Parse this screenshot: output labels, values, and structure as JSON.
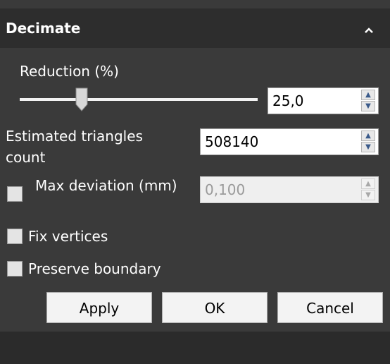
{
  "panel": {
    "title": "Decimate",
    "collapse_icon": "chevron-up-icon"
  },
  "reduction": {
    "label": "Reduction (%)",
    "value": "25,0",
    "slider_fraction": 0.26
  },
  "triangles": {
    "label_line1": "Estimated triangles",
    "label_line2": "count",
    "value": "508140"
  },
  "deviation": {
    "label": "Max deviation (mm)",
    "value": "0,100",
    "checked": false,
    "enabled": false
  },
  "fix_vertices": {
    "label": "Fix vertices",
    "checked": false
  },
  "preserve_boundary": {
    "label": "Preserve boundary",
    "checked": false
  },
  "buttons": {
    "apply": "Apply",
    "ok": "OK",
    "cancel": "Cancel"
  }
}
